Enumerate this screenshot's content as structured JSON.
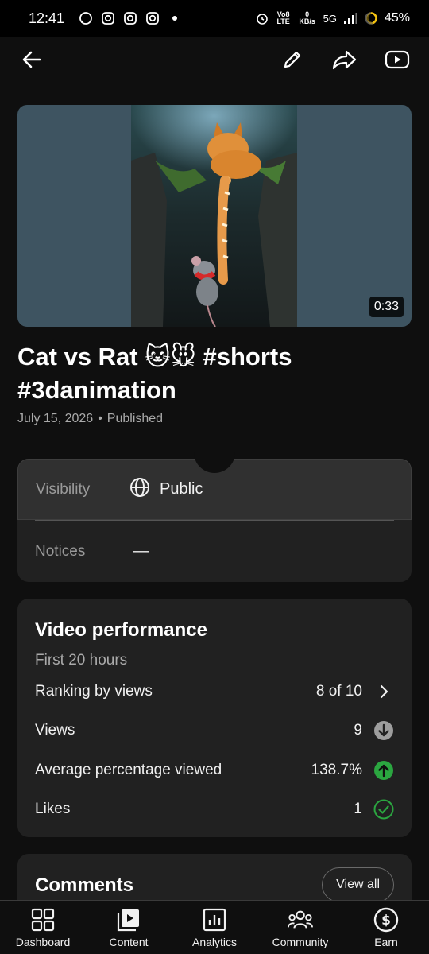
{
  "status_bar": {
    "time": "12:41",
    "network": "5G",
    "volte": "Vo8 LTE",
    "speed": "0 KB/s",
    "battery": "45%"
  },
  "header": {
    "back_icon": "arrow-left-icon",
    "edit_icon": "pencil-icon",
    "share_icon": "share-icon",
    "open_icon": "youtube-icon"
  },
  "video": {
    "duration": "0:33",
    "title": "Cat vs Rat 🐱🐭 #shorts #3danimation",
    "date": "July 15, 2026",
    "separator": "•",
    "status": "Published"
  },
  "details": {
    "visibility_label": "Visibility",
    "visibility_value": "Public",
    "notices_label": "Notices",
    "notices_value": "—"
  },
  "performance": {
    "title": "Video performance",
    "period": "First 20 hours",
    "rows": [
      {
        "label": "Ranking by views",
        "value": "8 of 10",
        "icon": "chevron-right-icon"
      },
      {
        "label": "Views",
        "value": "9",
        "icon": "arrow-down-circle-icon",
        "color": "#9e9e9e"
      },
      {
        "label": "Average percentage viewed",
        "value": "138.7%",
        "icon": "arrow-up-circle-icon",
        "color": "#2ba640"
      },
      {
        "label": "Likes",
        "value": "1",
        "icon": "check-circle-icon",
        "color": "#2ba640"
      }
    ]
  },
  "comments": {
    "title": "Comments",
    "view_all": "View all"
  },
  "nav": {
    "dashboard": "Dashboard",
    "content": "Content",
    "analytics": "Analytics",
    "community": "Community",
    "earn": "Earn"
  }
}
